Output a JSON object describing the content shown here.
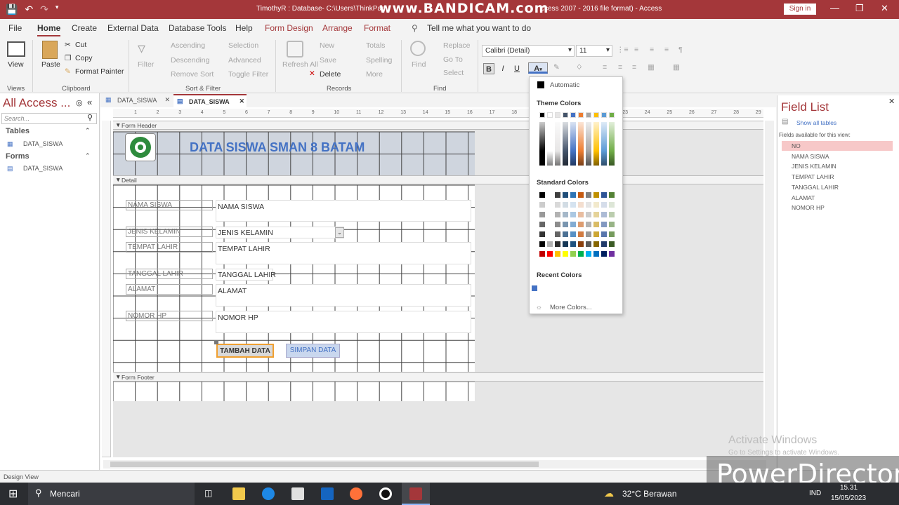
{
  "window": {
    "title": "TimothyR : Database- C:\\Users\\ThinkPad",
    "title_suffix": "ccess 2007 - 2016 file format)  -  Access",
    "watermark": "www.BANDICAM.com",
    "sign_in": "Sign in"
  },
  "menu": {
    "tabs": [
      "File",
      "Home",
      "Create",
      "External Data",
      "Database Tools",
      "Help",
      "Form Design",
      "Arrange",
      "Format"
    ],
    "tell_me": "Tell me what you want to do"
  },
  "ribbon": {
    "views": {
      "view": "View",
      "group": "Views"
    },
    "clipboard": {
      "paste": "Paste",
      "cut": "Cut",
      "copy": "Copy",
      "format_painter": "Format Painter",
      "group": "Clipboard"
    },
    "sort_filter": {
      "filter": "Filter",
      "ascending": "Ascending",
      "descending": "Descending",
      "remove_sort": "Remove Sort",
      "selection": "Selection",
      "advanced": "Advanced",
      "toggle_filter": "Toggle Filter",
      "group": "Sort & Filter"
    },
    "records": {
      "refresh_all": "Refresh All",
      "new": "New",
      "save": "Save",
      "delete": "Delete",
      "totals": "Totals",
      "spelling": "Spelling",
      "more": "More",
      "group": "Records"
    },
    "find": {
      "find": "Find",
      "replace": "Replace",
      "go_to": "Go To",
      "select": "Select",
      "group": "Find"
    },
    "text_formatting": {
      "font": "Calibri (Detail)",
      "size": "11",
      "bold": "B",
      "italic": "I",
      "underline": "U",
      "font_color": "A"
    }
  },
  "nav": {
    "header": "All Access ...",
    "search_placeholder": "Search...",
    "tables_label": "Tables",
    "tables": [
      "DATA_SISWA"
    ],
    "forms_label": "Forms",
    "forms": [
      "DATA_SISWA"
    ]
  },
  "doc_tabs": [
    {
      "label": "DATA_SISWA",
      "active": false
    },
    {
      "label": "DATA_SISWA",
      "active": true
    }
  ],
  "ruler": {
    "numbers": [
      "1",
      "2",
      "3",
      "4",
      "5",
      "6",
      "7",
      "8",
      "9",
      "10",
      "11",
      "12",
      "13",
      "14",
      "15",
      "16",
      "17",
      "18",
      "19",
      "20",
      "21",
      "22",
      "23",
      "24",
      "25",
      "26",
      "27",
      "28",
      "29"
    ]
  },
  "form": {
    "header_section": "Form Header",
    "detail_section": "Detail",
    "footer_section": "Form Footer",
    "title": "DATA SISWA SMAN 8 BATAM",
    "fields": [
      {
        "label": "NAMA SISWA",
        "value": "NAMA SISWA"
      },
      {
        "label": "JENIS KELAMIN",
        "value": "JENIS KELAMIN"
      },
      {
        "label": "TEMPAT LAHIR",
        "value": "TEMPAT LAHIR"
      },
      {
        "label": "TANGGAL LAHIR",
        "value": "TANGGAL LAHIR"
      },
      {
        "label": "ALAMAT",
        "value": "ALAMAT"
      },
      {
        "label": "NOMOR HP",
        "value": "NOMOR HP"
      }
    ],
    "buttons": {
      "add": "TAMBAH DATA",
      "save": "SIMPAN DATA"
    }
  },
  "color_picker": {
    "automatic": "Automatic",
    "theme_colors": "Theme Colors",
    "standard_colors": "Standard Colors",
    "recent_colors": "Recent Colors",
    "more_colors": "More Colors...",
    "theme_row": [
      "#000000",
      "#ffffff",
      "#e7e6e6",
      "#44546a",
      "#4472c4",
      "#ed7d31",
      "#a5a5a5",
      "#ffc000",
      "#5b9bd5",
      "#70ad47"
    ],
    "standard_row": [
      "#000000",
      "#ffffff",
      "#3f3f3f",
      "#1f4e79",
      "#2e75b6",
      "#c55a11",
      "#7f7f7f",
      "#bf9000",
      "#2f5597",
      "#548235"
    ],
    "standard_last": [
      "#c00000",
      "#ff0000",
      "#ffc000",
      "#ffff00",
      "#92d050",
      "#00b050",
      "#00b0f0",
      "#0070c0",
      "#002060",
      "#7030a0"
    ],
    "recent": [
      "#4472c4"
    ]
  },
  "field_list": {
    "title": "Field List",
    "show_all": "Show all tables",
    "available": "Fields available for this view:",
    "fields": [
      "NO",
      "NAMA SISWA",
      "JENIS KELAMIN",
      "TEMPAT LAHIR",
      "TANGGAL LAHIR",
      "ALAMAT",
      "NOMOR HP"
    ],
    "selected_index": 0
  },
  "status": {
    "left": "Design View"
  },
  "overlay": {
    "activate": "Activate Windows",
    "activate_sub": "Go to Settings to activate Windows.",
    "powerdirector": "PowerDirector"
  },
  "taskbar": {
    "search": "Mencari",
    "weather": "32°C  Berawan",
    "lang": "IND",
    "time": "15.31",
    "date": "15/05/2023"
  }
}
